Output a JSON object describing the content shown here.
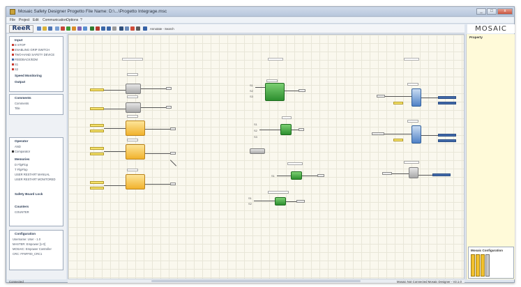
{
  "window": {
    "title": "Mosaic Safety Designer Progetto    File Name: D:\\...\\Progetto Integrage.msc",
    "minimize": "_",
    "maximize": "□",
    "close": "x"
  },
  "menu": [
    "File",
    "Project",
    "Edit",
    "Communication",
    "Options",
    "?"
  ],
  "toolbar": {
    "logo_text": "ReeR",
    "search_label": "Annotate - Search"
  },
  "brand": "MOSAIC",
  "left_panel": {
    "inputs_title": "Input",
    "inputs_items": [
      "E-STOP",
      "ENABLING GRIP SWITCH",
      "TWO-HAND SAFETY DEVICE",
      "FEEDBACK/EDM",
      "S1",
      "S2"
    ],
    "speed_title": "Speed Monitoring",
    "output_title": "Output",
    "comments_title": "Comments",
    "comments_items": [
      "Comments",
      "Title"
    ],
    "operator_title": "Operator",
    "operator_items": [
      "AND",
      "Comparator"
    ],
    "memories_title": "Memories",
    "memories_items": [
      "D FlipFlop",
      "T FlipFlop",
      "USER RESTART MANUAL",
      "USER RESTART MONITORED"
    ],
    "safety_title": "Safety Board Lock",
    "counters_title": "Counters",
    "counters_items": [
      "COUNTER"
    ],
    "config_title": "Configuration",
    "config_items": [
      "Username: User - 1.0",
      "MASTER: Empower [1-0]",
      "MOSAIC: Empower Controller",
      "CRC: FF6FF00_CRC1"
    ]
  },
  "right_panel": {
    "properties_title": "Property",
    "config_title": "Mosaic Configuration"
  },
  "status": {
    "left": "Connected",
    "right": "Mosaic Not Connected    Mosaic Designer - V2.1.0"
  },
  "colors": {
    "accent_orange": "#f1b22c",
    "accent_green": "#2d8f2f",
    "accent_blue": "#4f81c5",
    "canvas": "#faf8ee"
  }
}
